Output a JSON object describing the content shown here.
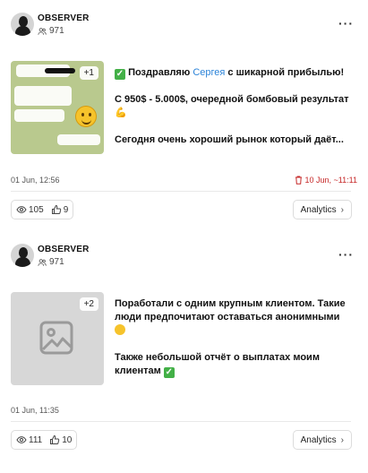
{
  "posts": [
    {
      "author": "OBSERVER",
      "subscribers": "971",
      "more": "···",
      "thumb_badge": "+1",
      "text": {
        "p1_a": "Поздравляю ",
        "p1_link": "Сергея",
        "p1_b": " с шикарной прибылью!",
        "p2": "С 950$ - 5.000$, очередной бомбовый результат",
        "p3": "Сегодня очень хороший рынок который даёт..."
      },
      "date": "01 Jun, 12:56",
      "delete_date": "10 Jun, ~11:11",
      "views": "105",
      "likes": "9",
      "analytics_label": "Analytics"
    },
    {
      "author": "OBSERVER",
      "subscribers": "971",
      "more": "···",
      "thumb_badge": "+2",
      "text": {
        "p1": "Поработали с одним крупным клиентом. Такие люди предпочитают оставаться анонимными",
        "p2": "Также небольшой отчёт о выплатах моим клиентам"
      },
      "date": "01 Jun, 11:35",
      "views": "111",
      "likes": "10",
      "analytics_label": "Analytics"
    }
  ],
  "colors": {
    "link": "#2b83d8",
    "delete": "#c62828",
    "border": "#dcdcdc"
  }
}
